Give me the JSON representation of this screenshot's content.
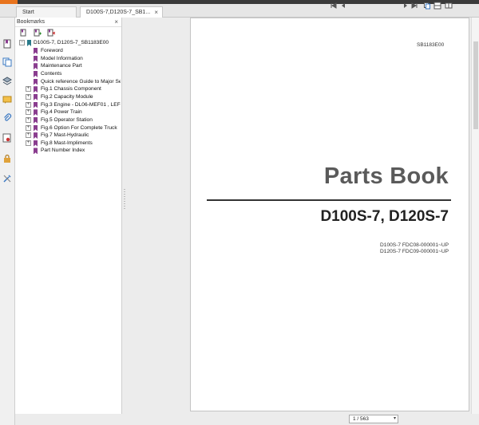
{
  "tabs": {
    "start": "Start",
    "doc": "D100S-7,D120S-7_SB1...",
    "close": "×"
  },
  "bookmarks_panel": {
    "title": "Bookmarks",
    "close": "×",
    "root": "D100S-7, D120S-7_SB1183E00",
    "items": [
      {
        "label": "Foreword",
        "expandable": false
      },
      {
        "label": "Model Information",
        "expandable": false
      },
      {
        "label": "Maintenance Part",
        "expandable": false
      },
      {
        "label": "Contents",
        "expandable": false
      },
      {
        "label": "Quick reference Guide to Major Se",
        "expandable": false
      },
      {
        "label": "Fig.1 Chassis Component",
        "expandable": true
      },
      {
        "label": "Fig.2 Capacity Module",
        "expandable": true
      },
      {
        "label": "Fig.3 Engine - DL06-MEF01 , LEF0:",
        "expandable": true
      },
      {
        "label": "Fig.4 Power Train",
        "expandable": true
      },
      {
        "label": "Fig.5 Operator Station",
        "expandable": true
      },
      {
        "label": "Fig.6 Option For Complete Truck",
        "expandable": true
      },
      {
        "label": "Fig.7 Mast-Hydraulic",
        "expandable": true
      },
      {
        "label": "Fig.8 Mast-Impliments",
        "expandable": true
      },
      {
        "label": "Part Number Index",
        "expandable": false
      }
    ]
  },
  "document": {
    "code": "SB1183E00",
    "title": "Parts Book",
    "models": "D100S-7, D120S-7",
    "serials": [
      "D100S-7  FDC08-000001~UP",
      "D120S-7  FDC09-000001~UP"
    ]
  },
  "statusbar": {
    "page_indicator": "1 / 563"
  },
  "colors": {
    "bookmark": "#8a3d8f",
    "accent": "#e8731c"
  }
}
